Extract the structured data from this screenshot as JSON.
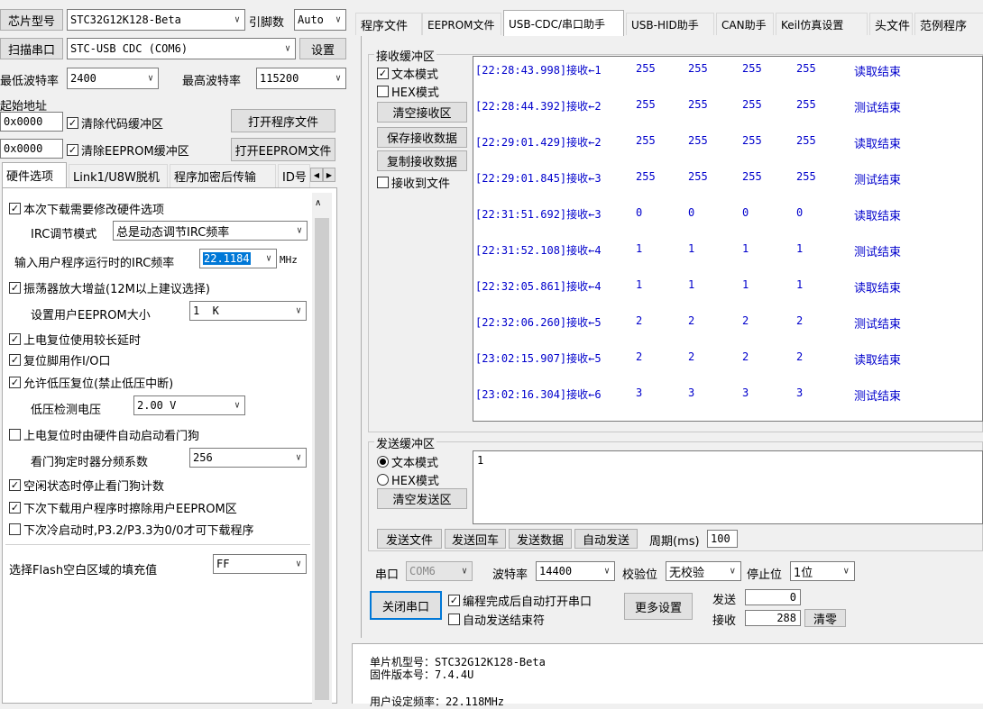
{
  "left": {
    "chip_btn": "芯片型号",
    "chip_value": "STC32G12K128-Beta",
    "pin_label": "引脚数",
    "pin_value": "Auto",
    "scan_btn": "扫描串口",
    "port_value": "STC-USB CDC (COM6)",
    "settings_btn": "设置",
    "min_baud_label": "最低波特率",
    "min_baud": "2400",
    "max_baud_label": "最高波特率",
    "max_baud": "115200",
    "start_addr_label": "起始地址",
    "addr1": "0x0000",
    "clear_code": "清除代码缓冲区",
    "open_prog": "打开程序文件",
    "addr2": "0x0000",
    "clear_eeprom": "清除EEPROM缓冲区",
    "open_eeprom": "打开EEPROM文件",
    "subtabs": [
      "硬件选项",
      "Link1/U8W脱机",
      "程序加密后传输",
      "ID号"
    ],
    "options": {
      "modify_hw": "本次下载需要修改硬件选项",
      "irc_mode_label": "IRC调节模式",
      "irc_mode": "总是动态调节IRC频率",
      "irc_freq_label": "输入用户程序运行时的IRC频率",
      "irc_freq": "22.1184",
      "irc_unit": "MHz",
      "osc_gain": "振荡器放大增益(12M以上建议选择)",
      "eeprom_size_label": "设置用户EEPROM大小",
      "eeprom_size": "1  K",
      "long_reset": "上电复位使用较长延时",
      "reset_io": "复位脚用作I/O口",
      "lvr": "允许低压复位(禁止低压中断)",
      "lv_label": "低压检测电压",
      "lv_value": "2.00 V",
      "wdt_auto": "上电复位时由硬件自动启动看门狗",
      "wdt_div_label": "看门狗定时器分频系数",
      "wdt_div": "256",
      "idle_stop_wdt": "空闲状态时停止看门狗计数",
      "erase_eeprom": "下次下载用户程序时擦除用户EEPROM区",
      "p32p33": "下次冷启动时,P3.2/P3.3为0/0才可下载程序",
      "fill_label": "选择Flash空白区域的填充值",
      "fill_value": "FF"
    }
  },
  "tabs": [
    "程序文件",
    "EEPROM文件",
    "USB-CDC/串口助手",
    "USB-HID助手",
    "CAN助手",
    "Keil仿真设置",
    "头文件",
    "范例程序"
  ],
  "recv": {
    "legend": "接收缓冲区",
    "text_mode": "文本模式",
    "hex_mode": "HEX模式",
    "clear": "清空接收区",
    "save": "保存接收数据",
    "copy": "复制接收数据",
    "to_file": "接收到文件",
    "rows": [
      {
        "t": "[22:28:43.998]接收←1",
        "v": [
          "255",
          "255",
          "255",
          "255"
        ],
        "m": "读取结束"
      },
      {
        "t": "[22:28:44.392]接收←2",
        "v": [
          "255",
          "255",
          "255",
          "255"
        ],
        "m": "测试结束"
      },
      {
        "t": "[22:29:01.429]接收←2",
        "v": [
          "255",
          "255",
          "255",
          "255"
        ],
        "m": "读取结束"
      },
      {
        "t": "[22:29:01.845]接收←3",
        "v": [
          "255",
          "255",
          "255",
          "255"
        ],
        "m": "测试结束"
      },
      {
        "t": "[22:31:51.692]接收←3",
        "v": [
          "0",
          "0",
          "0",
          "0"
        ],
        "m": "读取结束"
      },
      {
        "t": "[22:31:52.108]接收←4",
        "v": [
          "1",
          "1",
          "1",
          "1"
        ],
        "m": "测试结束"
      },
      {
        "t": "[22:32:05.861]接收←4",
        "v": [
          "1",
          "1",
          "1",
          "1"
        ],
        "m": "读取结束"
      },
      {
        "t": "[22:32:06.260]接收←5",
        "v": [
          "2",
          "2",
          "2",
          "2"
        ],
        "m": "测试结束"
      },
      {
        "t": "[23:02:15.907]接收←5",
        "v": [
          "2",
          "2",
          "2",
          "2"
        ],
        "m": "读取结束"
      },
      {
        "t": "[23:02:16.304]接收←6",
        "v": [
          "3",
          "3",
          "3",
          "3"
        ],
        "m": "测试结束"
      }
    ]
  },
  "send": {
    "legend": "发送缓冲区",
    "text_mode": "文本模式",
    "hex_mode": "HEX模式",
    "clear": "清空发送区",
    "content": "1",
    "send_file": "发送文件",
    "send_enter": "发送回车",
    "send_data": "发送数据",
    "auto_send": "自动发送",
    "period_label": "周期(ms)",
    "period": "100"
  },
  "serial": {
    "port_label": "串口",
    "port": "COM6",
    "baud_label": "波特率",
    "baud": "14400",
    "parity_label": "校验位",
    "parity": "无校验",
    "stop_label": "停止位",
    "stop": "1位",
    "close_btn": "关闭串口",
    "auto_open": "编程完成后自动打开串口",
    "auto_end": "自动发送结束符",
    "more_btn": "更多设置",
    "send_label": "发送",
    "send_count": "0",
    "recv_label": "接收",
    "recv_count": "288",
    "reset_btn": "清零"
  },
  "info": {
    "chip": "单片机型号：STC32G12K128-Beta",
    "fw": "固件版本号：7.4.4U",
    "freq": "用户设定频率：22.118MHz"
  }
}
